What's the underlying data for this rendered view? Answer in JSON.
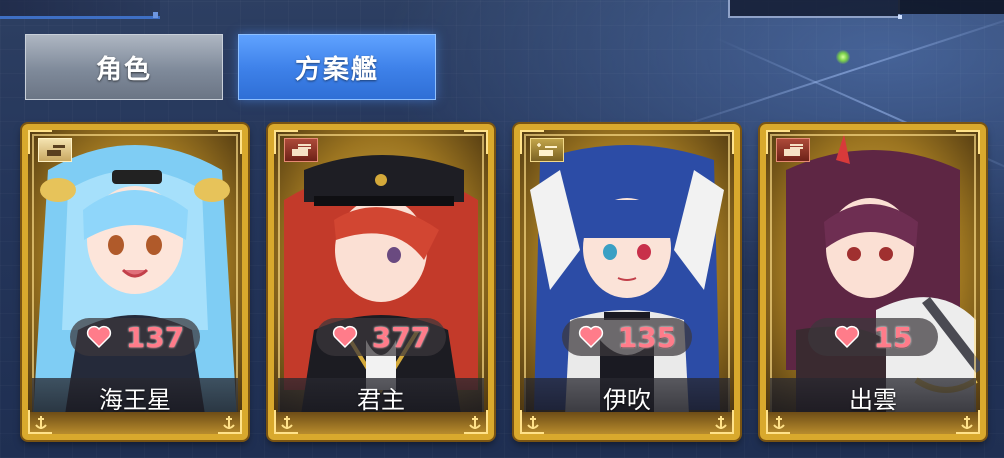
{
  "tabs": [
    {
      "label": "角色",
      "active": false
    },
    {
      "label": "方案艦",
      "active": true
    }
  ],
  "cards": [
    {
      "name": "海王星",
      "affinity": "137",
      "type_icon": "destroyer-gun-icon",
      "accent": "#8ccfff"
    },
    {
      "name": "君主",
      "affinity": "377",
      "type_icon": "battleship-turret-icon",
      "accent": "#c9322a"
    },
    {
      "name": "伊吹",
      "affinity": "135",
      "type_icon": "cruiser-gun-icon",
      "accent": "#2f4fa8"
    },
    {
      "name": "出雲",
      "affinity": "15",
      "type_icon": "battleship-turret-icon",
      "accent": "#6b2a4a"
    }
  ],
  "colors": {
    "tab_active": "#3d80e8",
    "tab_inactive": "#7f8a9a",
    "frame_gold": "#d9a92d",
    "affinity_text": "#ff7c8a"
  }
}
